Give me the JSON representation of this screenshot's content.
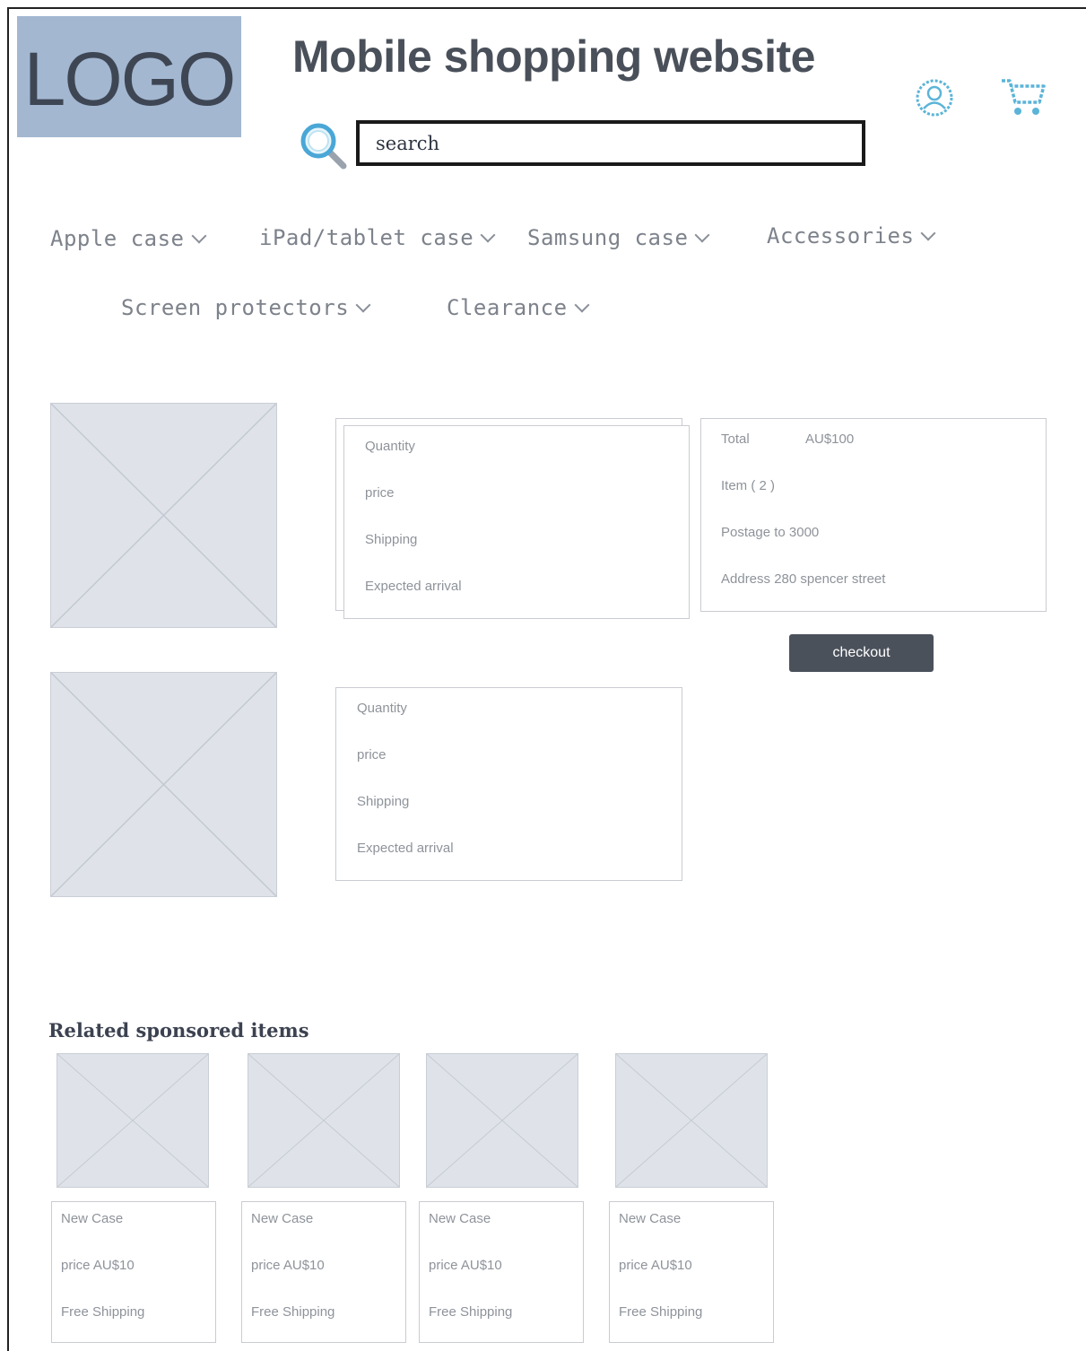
{
  "header": {
    "logo_text": "LOGO",
    "title": "Mobile shopping website",
    "search_placeholder": "search"
  },
  "nav": [
    {
      "label": "Apple case"
    },
    {
      "label": "iPad/tablet case"
    },
    {
      "label": "Samsung case"
    },
    {
      "label": "Accessories"
    },
    {
      "label": "Screen protectors"
    },
    {
      "label": "Clearance"
    }
  ],
  "cart_items": [
    {
      "quantity_label": "Quantity",
      "price_label": "price",
      "shipping_label": "Shipping",
      "arrival_label": "Expected arrival"
    },
    {
      "quantity_label": "Quantity",
      "price_label": "price",
      "shipping_label": "Shipping",
      "arrival_label": "Expected arrival"
    }
  ],
  "summary": {
    "total_label": "Total",
    "total_value": "AU$100",
    "items": "Item ( 2 )",
    "postage": "Postage to 3000",
    "address": "Address 280 spencer street",
    "checkout_label": "checkout"
  },
  "related": {
    "title": "Related sponsored items",
    "items": [
      {
        "name": "New Case",
        "price": "price AU$10",
        "shipping": "Free Shipping"
      },
      {
        "name": "New Case",
        "price": "price AU$10",
        "shipping": "Free Shipping"
      },
      {
        "name": "New Case",
        "price": "price AU$10",
        "shipping": "Free Shipping"
      },
      {
        "name": "New Case",
        "price": "price AU$10",
        "shipping": "Free Shipping"
      }
    ]
  },
  "colors": {
    "logo_bg": "#a3b7d1",
    "accent_icon": "#5bb4d8",
    "checkout_bg": "#4b515b",
    "placeholder_bg": "#dfe3e9"
  }
}
